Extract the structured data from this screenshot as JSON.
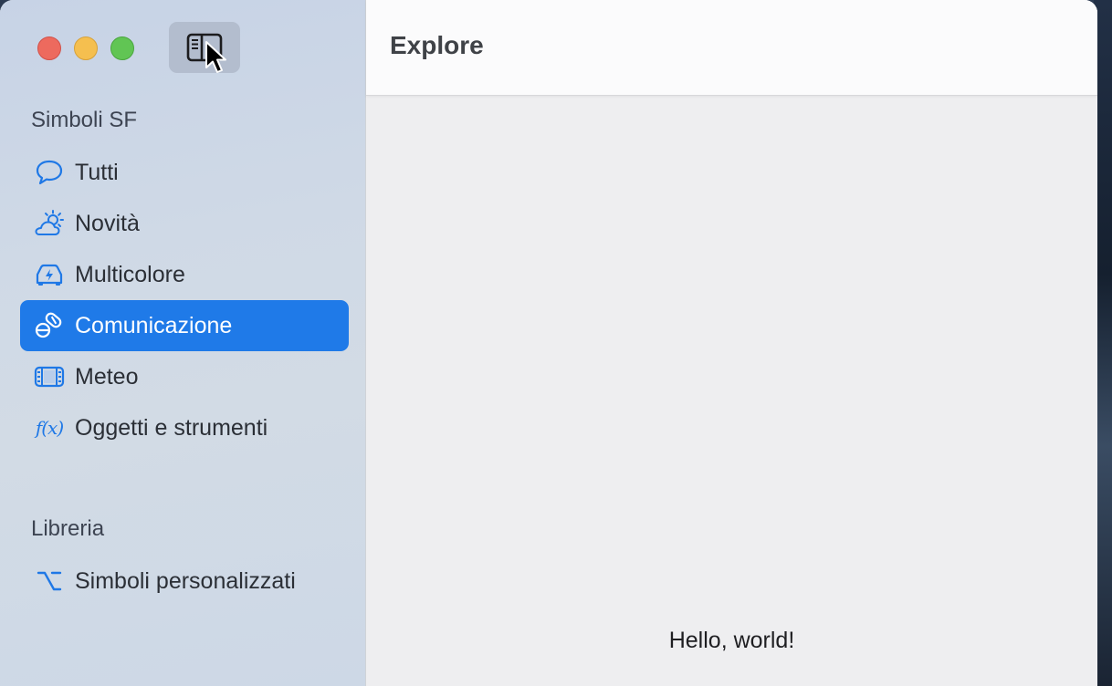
{
  "sidebar": {
    "toggle_button_icon": "sidebar-toggle-icon",
    "sections": [
      {
        "title": "Simboli SF",
        "items": [
          {
            "label": "Tutti",
            "icon": "speech-bubble-icon"
          },
          {
            "label": "Novità",
            "icon": "cloud-sun-icon"
          },
          {
            "label": "Multicolore",
            "icon": "car-bolt-icon"
          },
          {
            "label": "Comunicazione",
            "icon": "pills-icon",
            "selected": true
          },
          {
            "label": "Meteo",
            "icon": "film-icon"
          },
          {
            "label": "Oggetti e strumenti",
            "icon": "function-icon",
            "glyph": "f(x)"
          }
        ]
      },
      {
        "title": "Libreria",
        "items": [
          {
            "label": "Simboli personalizzati",
            "icon": "option-key-icon"
          }
        ]
      }
    ]
  },
  "main": {
    "title": "Explore",
    "content_text": "Hello, world!"
  },
  "colors": {
    "accent": "#1f7ae8",
    "icon": "#1f78e6",
    "close": "#ed6a5e",
    "minimize": "#f5bf4f",
    "zoom": "#61c554"
  }
}
